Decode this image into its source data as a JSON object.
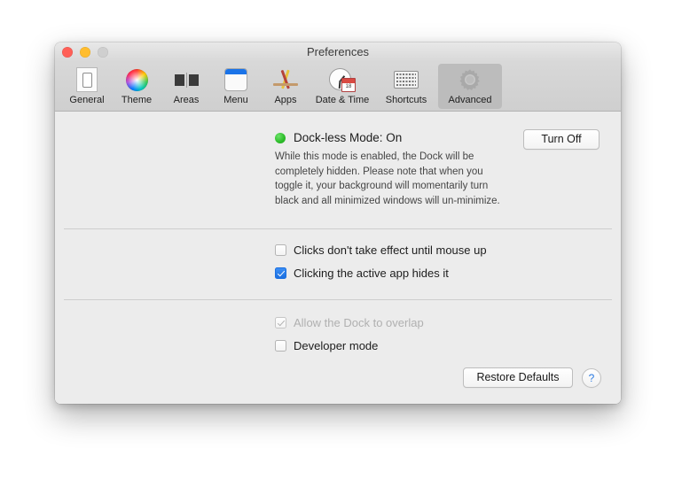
{
  "window": {
    "title": "Preferences",
    "traffic_lights": [
      {
        "name": "close",
        "color": "#ff5f57"
      },
      {
        "name": "minimize",
        "color": "#ffbd2e"
      },
      {
        "name": "zoom",
        "color": "#cfcfcf"
      }
    ]
  },
  "toolbar": {
    "items": [
      {
        "label": "General",
        "icon": "general-switch-icon",
        "selected": false
      },
      {
        "label": "Theme",
        "icon": "color-wheel-icon",
        "selected": false
      },
      {
        "label": "Areas",
        "icon": "screen-areas-icon",
        "selected": false
      },
      {
        "label": "Menu",
        "icon": "menu-bar-icon",
        "selected": false
      },
      {
        "label": "Apps",
        "icon": "app-store-icon",
        "selected": false
      },
      {
        "label": "Date & Time",
        "icon": "clock-calendar-icon",
        "selected": false
      },
      {
        "label": "Shortcuts",
        "icon": "keyboard-icon",
        "selected": false
      },
      {
        "label": "Advanced",
        "icon": "gear-icon",
        "selected": true
      }
    ]
  },
  "main": {
    "status": {
      "indicator_color": "#2fbe2c",
      "title": "Dock-less Mode: On",
      "description": "While this mode is enabled, the Dock will be completely hidden. Please note that when you toggle it, your background will momentarily turn black and all minimized windows will un-minimize.",
      "toggle_button": "Turn Off"
    },
    "options_group_1": [
      {
        "label": "Clicks don't take effect until mouse up",
        "checked": false,
        "disabled": false
      },
      {
        "label": "Clicking the active app hides it",
        "checked": true,
        "disabled": false
      }
    ],
    "options_group_2": [
      {
        "label": "Allow the Dock to overlap",
        "checked": true,
        "disabled": true
      },
      {
        "label": "Developer mode",
        "checked": false,
        "disabled": false
      }
    ],
    "footer": {
      "restore_defaults": "Restore Defaults",
      "help": "?"
    }
  },
  "colors": {
    "accent_checkbox": "#1b6fe0",
    "help_glyph": "#2a7ae2",
    "status_green": "#2fbe2c"
  }
}
